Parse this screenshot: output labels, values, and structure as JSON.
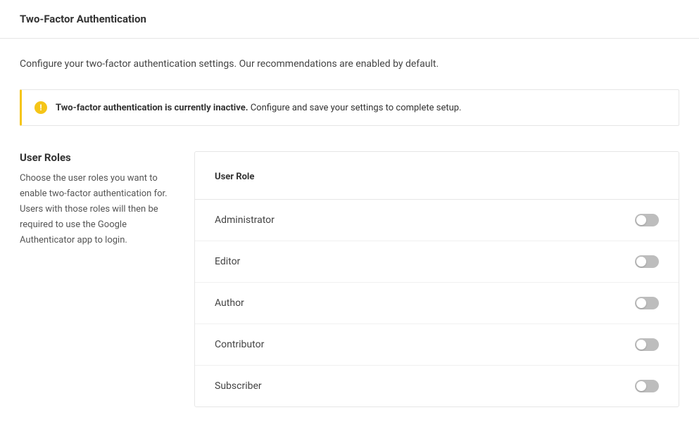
{
  "header": {
    "title": "Two-Factor Authentication"
  },
  "intro": "Configure your two-factor authentication settings. Our recommendations are enabled by default.",
  "notice": {
    "icon_glyph": "!",
    "strong": "Two-factor authentication is currently inactive.",
    "rest": " Configure and save your settings to complete setup."
  },
  "section": {
    "title": "User Roles",
    "description": "Choose the user roles you want to enable two-factor authentication for. Users with those roles will then be required to use the Google Authenticator app to login."
  },
  "roles_table": {
    "header": "User Role",
    "rows": [
      {
        "label": "Administrator",
        "enabled": false
      },
      {
        "label": "Editor",
        "enabled": false
      },
      {
        "label": "Author",
        "enabled": false
      },
      {
        "label": "Contributor",
        "enabled": false
      },
      {
        "label": "Subscriber",
        "enabled": false
      }
    ]
  }
}
